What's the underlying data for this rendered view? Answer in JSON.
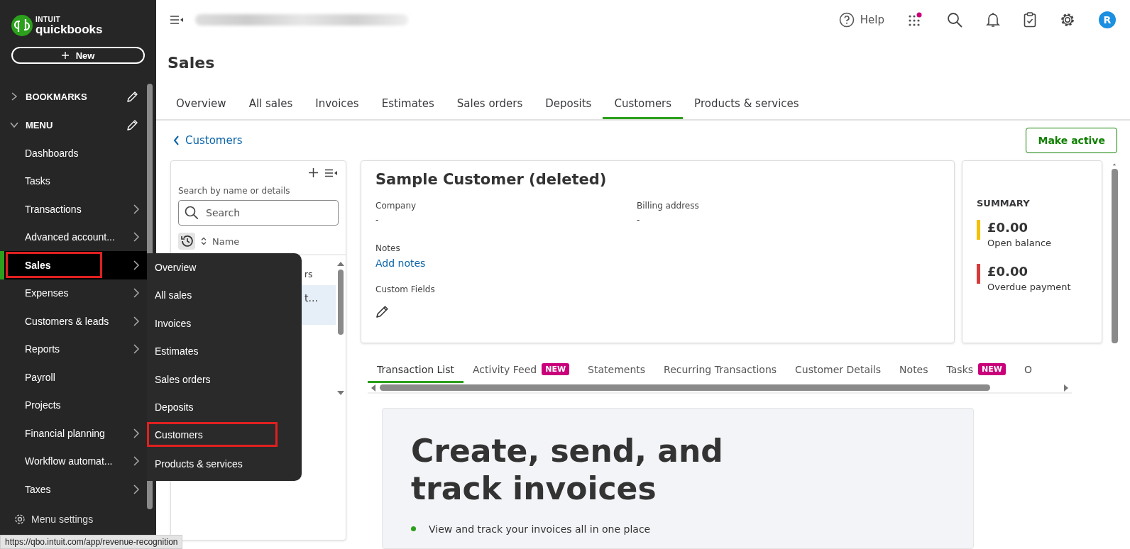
{
  "sidebar": {
    "logo": {
      "brand_top": "INTUIT",
      "brand": "quickbooks"
    },
    "new_button": "New",
    "sections": [
      {
        "label": "BOOKMARKS",
        "expanded": false
      },
      {
        "label": "MENU",
        "expanded": true
      }
    ],
    "items": [
      {
        "label": "Dashboards",
        "has_submenu": false,
        "selected": false,
        "outlined": false
      },
      {
        "label": "Tasks",
        "has_submenu": false,
        "selected": false,
        "outlined": false
      },
      {
        "label": "Transactions",
        "has_submenu": true,
        "selected": false,
        "outlined": false
      },
      {
        "label": "Advanced account...",
        "has_submenu": true,
        "selected": false,
        "outlined": false
      },
      {
        "label": "Sales",
        "has_submenu": true,
        "selected": true,
        "outlined": true
      },
      {
        "label": "Expenses",
        "has_submenu": true,
        "selected": false,
        "outlined": false
      },
      {
        "label": "Customers & leads",
        "has_submenu": true,
        "selected": false,
        "outlined": false
      },
      {
        "label": "Reports",
        "has_submenu": true,
        "selected": false,
        "outlined": false
      },
      {
        "label": "Payroll",
        "has_submenu": false,
        "selected": false,
        "outlined": false
      },
      {
        "label": "Projects",
        "has_submenu": false,
        "selected": false,
        "outlined": false
      },
      {
        "label": "Financial planning",
        "has_submenu": true,
        "selected": false,
        "outlined": false
      },
      {
        "label": "Workflow automat...",
        "has_submenu": true,
        "selected": false,
        "outlined": false
      },
      {
        "label": "Taxes",
        "has_submenu": true,
        "selected": false,
        "outlined": false
      }
    ],
    "menu_settings": "Menu settings"
  },
  "flyout": {
    "items": [
      {
        "label": "Overview",
        "outlined": false
      },
      {
        "label": "All sales",
        "outlined": false
      },
      {
        "label": "Invoices",
        "outlined": false
      },
      {
        "label": "Estimates",
        "outlined": false
      },
      {
        "label": "Sales orders",
        "outlined": false
      },
      {
        "label": "Deposits",
        "outlined": false
      },
      {
        "label": "Customers",
        "outlined": true
      },
      {
        "label": "Products & services",
        "outlined": false
      }
    ]
  },
  "top_bar": {
    "help": "Help",
    "apps_notification": true,
    "avatar": "R"
  },
  "page": {
    "title": "Sales",
    "tabs": [
      {
        "label": "Overview",
        "selected": false
      },
      {
        "label": "All sales",
        "selected": false
      },
      {
        "label": "Invoices",
        "selected": false
      },
      {
        "label": "Estimates",
        "selected": false
      },
      {
        "label": "Sales orders",
        "selected": false
      },
      {
        "label": "Deposits",
        "selected": false
      },
      {
        "label": "Customers",
        "selected": true
      },
      {
        "label": "Products & services",
        "selected": false
      }
    ],
    "back_link": "Customers",
    "make_active": "Make active"
  },
  "customer_list": {
    "search_label": "Search by name or details",
    "placeholder": "Search",
    "column": "Name",
    "rows": [
      {
        "text": "rs",
        "selected": false
      },
      {
        "text": "t...",
        "selected": true
      }
    ]
  },
  "customer": {
    "name": "Sample Customer (deleted)",
    "fields": [
      {
        "label": "Company",
        "value": "-"
      },
      {
        "label": "Billing address",
        "value": "-"
      }
    ],
    "notes_label": "Notes",
    "add_notes": "Add notes",
    "custom_fields": "Custom Fields"
  },
  "summary": {
    "title": "SUMMARY",
    "items": [
      {
        "amount": "£0.00",
        "label": "Open balance",
        "color": "#f5c000"
      },
      {
        "amount": "£0.00",
        "label": "Overdue payment",
        "color": "#d93b3b"
      }
    ]
  },
  "detail_tabs": [
    {
      "label": "Transaction List",
      "selected": true
    },
    {
      "label": "Activity Feed",
      "selected": false,
      "badge": "NEW"
    },
    {
      "label": "Statements",
      "selected": false
    },
    {
      "label": "Recurring Transactions",
      "selected": false
    },
    {
      "label": "Customer Details",
      "selected": false
    },
    {
      "label": "Notes",
      "selected": false
    },
    {
      "label": "Tasks",
      "selected": false,
      "badge": "NEW"
    },
    {
      "label": "O",
      "selected": false
    }
  ],
  "promo": {
    "heading": "Create, send, and track invoices",
    "bullets": [
      "View and track your invoices all in one place"
    ]
  },
  "status_url": "https://qbo.intuit.com/app/revenue-recognition"
}
